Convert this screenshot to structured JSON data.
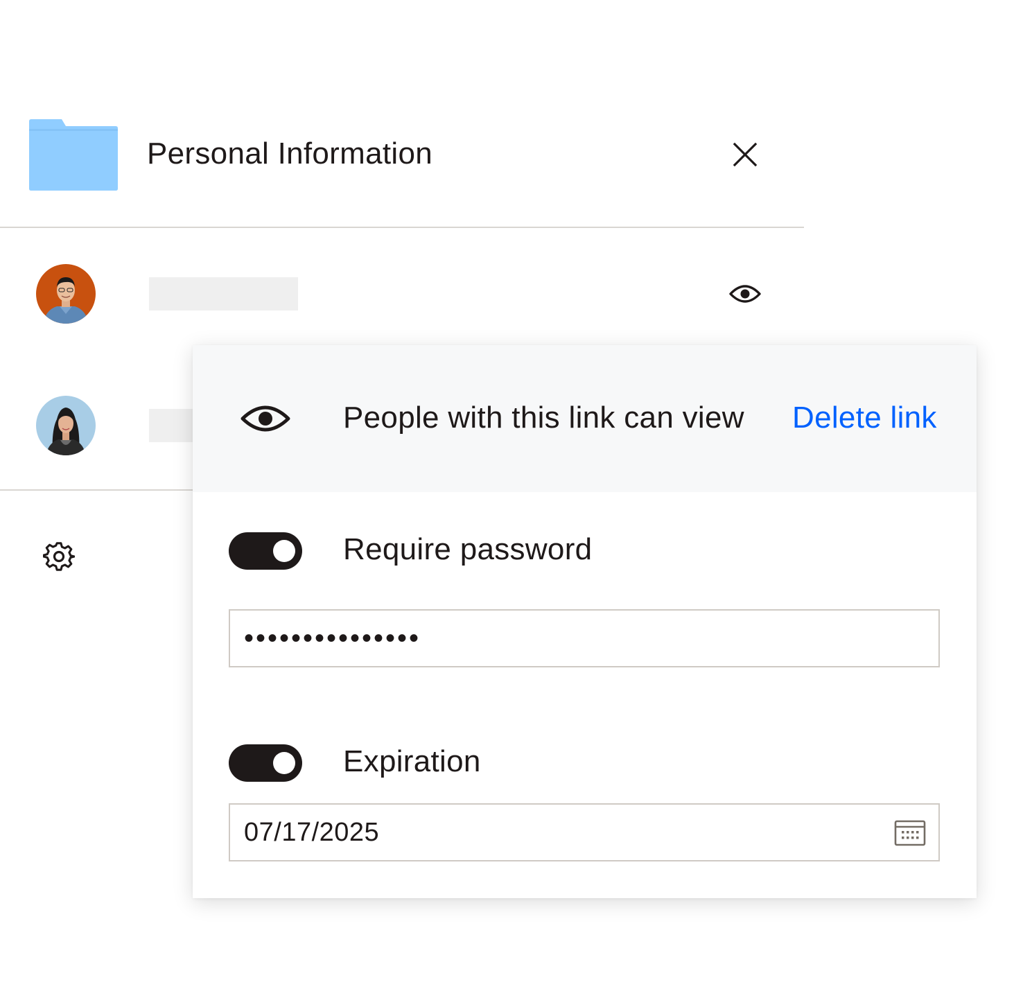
{
  "header": {
    "folder_icon": "folder-icon",
    "title": "Personal Information",
    "close_icon": "close-icon"
  },
  "members": [
    {
      "avatar": "avatar-man-orange-background",
      "name": "",
      "permission_icon": "eye-icon"
    },
    {
      "avatar": "avatar-woman-blue-background",
      "name": ""
    }
  ],
  "settings_icon": "gear-icon",
  "link_settings": {
    "access_icon": "eye-icon",
    "access_text": "People with this link can view",
    "delete_label": "Delete link",
    "require_password": {
      "label": "Require password",
      "enabled": true,
      "value": "•••••••••••••••"
    },
    "expiration": {
      "label": "Expiration",
      "enabled": true,
      "value": "07/17/2025",
      "calendar_icon": "calendar-icon"
    }
  },
  "colors": {
    "folder": "#90CDFF",
    "link_blue": "#0061FE",
    "toggle_on": "#1E1919",
    "panel_header_bg": "#F7F8F9",
    "divider": "#D9D6D2"
  }
}
